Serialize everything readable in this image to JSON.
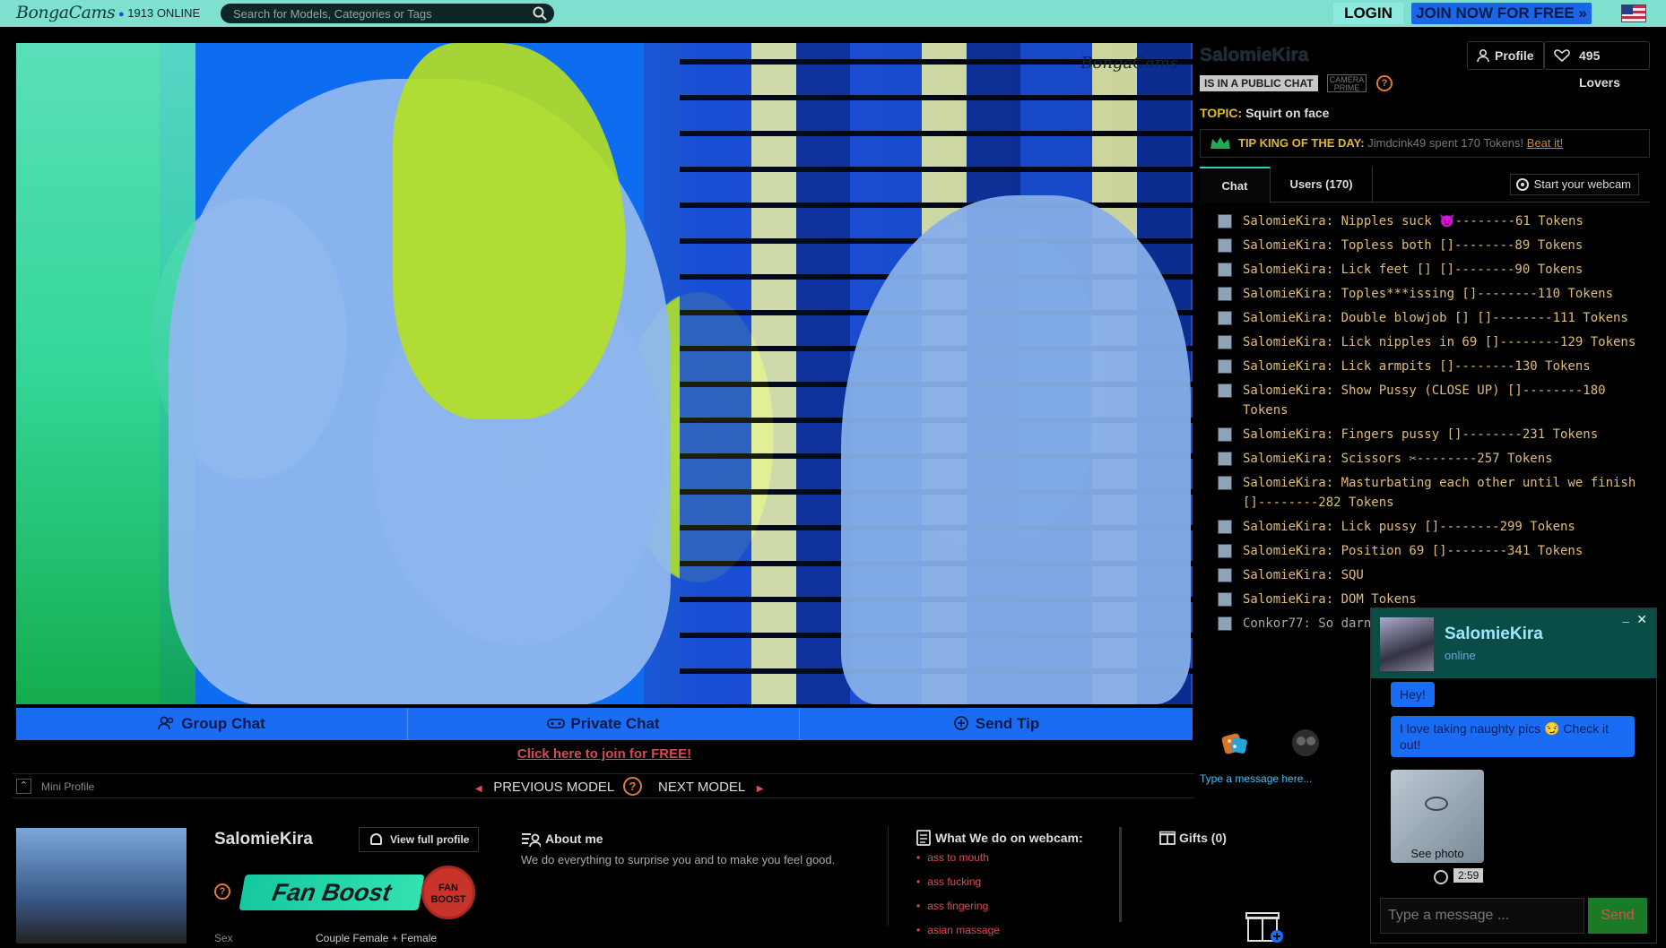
{
  "header": {
    "logo_text": "BongaCams",
    "online_text": "1913 ONLINE",
    "search_placeholder": "Search for Models, Categories or Tags",
    "login_label": "LOGIN",
    "join_label": "JOIN NOW FOR FREE »"
  },
  "video": {
    "watermark": "BongaCams"
  },
  "actions": {
    "group_chat": "Group Chat",
    "private_chat": "Private Chat",
    "send_tip": "Send Tip",
    "join_free": "Click here to join for FREE!"
  },
  "nav": {
    "mini_profile": "Mini Profile",
    "prev": "PREVIOUS MODEL",
    "next": "NEXT MODEL",
    "help": "?"
  },
  "model": {
    "name": "SalomieKira",
    "profile_btn": "Profile",
    "lovers_btn": "495 Lovers",
    "status_badge": "IS IN A PUBLIC CHAT",
    "prime_label": "CAMERA PRIME",
    "topic_label": "TOPIC:",
    "topic_value": "Squirt on face",
    "tip_king_label": "TIP KING OF THE DAY:",
    "tip_king_text": "Jimdcink49 spent 170 Tokens!",
    "beat_it": "Beat it!"
  },
  "tabs": {
    "chat": "Chat",
    "users": "Users (170)",
    "start_webcam": "Start your webcam"
  },
  "chat": {
    "messages": [
      "SalomieKira: Nipples suck  😈--------61 Tokens",
      "SalomieKira: Topless both  []--------89 Tokens",
      "SalomieKira: Lick feet  []  []--------90 Tokens",
      "SalomieKira: Toples***issing  []--------110 Tokens",
      "SalomieKira: Double blowjob  []  []--------111 Tokens",
      "SalomieKira: Lick nipples in 69  []--------129 Tokens",
      "SalomieKira: Lick armpits  []--------130 Tokens",
      "SalomieKira: Show Pussy (CLOSE UP)  []--------180 Tokens",
      "SalomieKira: Fingers pussy  []--------231 Tokens",
      "SalomieKira: Scissors  ✂--------257 Tokens",
      "SalomieKira: Masturbating each other until we finish []--------282 Tokens",
      "SalomieKira: Lick pussy  []--------299 Tokens",
      "SalomieKira: Position 69  []--------341 Tokens",
      "SalomieKira: SQU",
      "SalomieKira: DOM Tokens",
      "Conkor77: So darn"
    ],
    "composer_placeholder": "Type a message here..."
  },
  "messenger": {
    "name": "SalomieKira",
    "status": "online",
    "bubble1": "Hey!",
    "bubble2": "I love taking naughty pics 😏 Check it out!",
    "photo_label": "See photo",
    "duration": "2:59",
    "input_placeholder": "Type a message ...",
    "send_label": "Send",
    "minimize": "–",
    "close": "✕"
  },
  "profile": {
    "name": "SalomieKira",
    "view_full": "View full profile",
    "fan_boost": "Fan Boost",
    "fan_boost_badge": "FAN BOOST",
    "sex_label": "Sex",
    "sex_value": "Couple Female + Female",
    "about_title": "About me",
    "about_text": "We do everything to surprise you and to make you feel good.",
    "webcam_title": "What We do on webcam:",
    "webcam_tags": [
      "ass to mouth",
      "ass fucking",
      "ass fingering",
      "asian massage"
    ],
    "gifts_title": "Gifts (0)"
  },
  "colors": {
    "header_bg": "#7fe0d0",
    "accent_blue": "#1a6cf2",
    "tag_red": "#e04a50",
    "chat_text": "#e0bc78"
  }
}
